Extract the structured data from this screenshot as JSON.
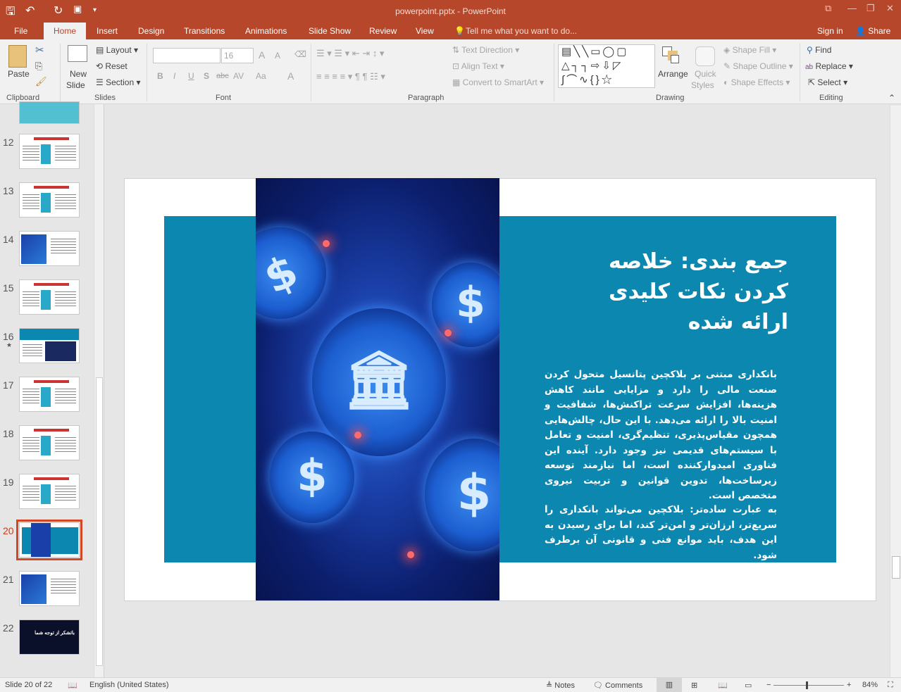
{
  "window": {
    "title": "powerpoint.pptx - PowerPoint"
  },
  "quick_access": [
    "save-icon",
    "undo-icon",
    "redo-icon",
    "start-from-beginning-icon",
    "customize-icon"
  ],
  "tabs": [
    {
      "label": "File"
    },
    {
      "label": "Home",
      "active": true
    },
    {
      "label": "Insert"
    },
    {
      "label": "Design"
    },
    {
      "label": "Transitions"
    },
    {
      "label": "Animations"
    },
    {
      "label": "Slide Show"
    },
    {
      "label": "Review"
    },
    {
      "label": "View"
    }
  ],
  "tell_me": "Tell me what you want to do...",
  "sign_in": "Sign in",
  "share": "Share",
  "ribbon": {
    "clipboard": {
      "paste": "Paste",
      "group": "Clipboard"
    },
    "slides": {
      "new_slide_1": "New",
      "new_slide_2": "Slide",
      "layout": "Layout",
      "reset": "Reset",
      "section": "Section",
      "group": "Slides"
    },
    "font": {
      "font_name": "",
      "font_size": "16",
      "bold": "B",
      "italic": "I",
      "underline": "U",
      "shadow": "S",
      "strike": "abc",
      "spacing": "AV",
      "case": "Aa",
      "color": "A",
      "grow": "A",
      "shrink": "A",
      "group": "Font"
    },
    "paragraph": {
      "text_direction": "Text Direction",
      "align_text": "Align Text",
      "smartart": "Convert to SmartArt",
      "group": "Paragraph"
    },
    "drawing": {
      "arrange": "Arrange",
      "quick_1": "Quick",
      "quick_2": "Styles",
      "shape_fill": "Shape Fill",
      "shape_outline": "Shape Outline",
      "shape_effects": "Shape Effects",
      "group": "Drawing"
    },
    "editing": {
      "find": "Find",
      "replace": "Replace",
      "select": "Select",
      "group": "Editing"
    }
  },
  "thumbnails": [
    {
      "num": "12"
    },
    {
      "num": "13"
    },
    {
      "num": "14"
    },
    {
      "num": "15"
    },
    {
      "num": "16",
      "star": "★"
    },
    {
      "num": "17"
    },
    {
      "num": "18"
    },
    {
      "num": "19"
    },
    {
      "num": "20",
      "selected": true
    },
    {
      "num": "21"
    },
    {
      "num": "22",
      "text": "باتشکر از توجه شما"
    }
  ],
  "slide": {
    "title": "جمع بندی: خلاصه کردن نکات کلیدی ارائه شده",
    "paragraph1": "بانکداری مبتنی بر بلاکچین پتانسیل متحول کردن صنعت مالی را دارد و مزایایی مانند کاهش هزینه‌ها، افزایش سرعت تراکنش‌ها، شفافیت و امنیت بالا را ارائه می‌دهد. با این حال، چالش‌هایی همچون مقیاس‌پذیری، تنظیم‌گری، امنیت و تعامل با سیستم‌های قدیمی نیز وجود دارد. آینده این فناوری امیدوارکننده است، اما نیازمند توسعه زیرساخت‌ها، تدوین قوانین و تربیت نیروی متخصص است.",
    "paragraph2": "به عبارت ساده‌تر: بلاکچین می‌تواند بانکداری را سریع‌تر، ارزان‌تر و امن‌تر کند، اما برای رسیدن به این هدف، باید موانع فنی و قانونی آن برطرف شود.",
    "coin_symbol": "$",
    "colors": {
      "panel": "#0b87b0",
      "accent": "#b7472a"
    }
  },
  "status": {
    "slide_info": "Slide 20 of 22",
    "language": "English (United States)",
    "notes": "Notes",
    "comments": "Comments",
    "zoom": "84%",
    "zoom_level_percent": 84
  }
}
